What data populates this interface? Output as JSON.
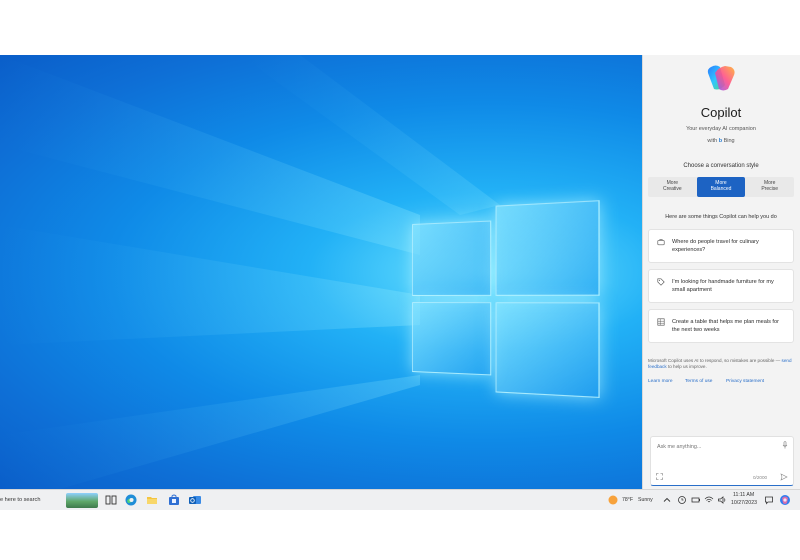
{
  "copilot": {
    "title": "Copilot",
    "subtitle": "Your everyday AI companion",
    "with_prefix": "with",
    "with_brand": "Bing",
    "choose_label": "Choose a conversation style",
    "styles": [
      {
        "label": "More\nCreative",
        "active": false
      },
      {
        "label": "More\nBalanced",
        "active": true
      },
      {
        "label": "More\nPrecise",
        "active": false
      }
    ],
    "help_heading": "Here are some things Copilot can help you do",
    "suggestions": [
      {
        "icon": "briefcase-icon",
        "text": "Where do people travel for culinary experiences?"
      },
      {
        "icon": "tag-icon",
        "text": "I'm looking for handmade furniture for my small apartment"
      },
      {
        "icon": "table-icon",
        "text": "Create a table that helps me plan meals for the next two weeks"
      }
    ],
    "disclaimer": "Microsoft Copilot uses AI to respond, so mistakes are possible",
    "disclaimer_link": "send feedback",
    "disclaimer_tail": "to help us improve.",
    "links": [
      "Learn more",
      "Terms of use",
      "Privacy statement"
    ],
    "input_placeholder": "Ask me anything...",
    "char_count": "0/2000",
    "accent": "#1d63c3"
  },
  "taskbar": {
    "search_text": "e here to search",
    "weather_temp": "78°F",
    "weather_condition": "Sunny",
    "time": "11:11 AM",
    "date": "10/27/2023"
  },
  "desktop": {
    "wallpaper_colors": [
      "#6fe4ff",
      "#0f8ae7",
      "#0a5ec9"
    ]
  }
}
